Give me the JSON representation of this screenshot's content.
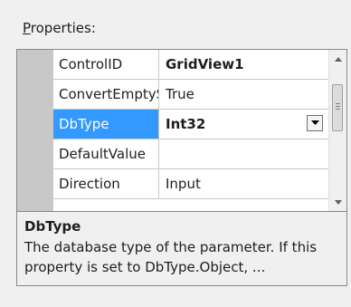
{
  "label": {
    "prefix": "P",
    "rest": "roperties:"
  },
  "grid": {
    "rows": [
      {
        "name": "ControlID",
        "value": "GridView1",
        "value_bold": true,
        "selected": false
      },
      {
        "name": "ConvertEmptyS",
        "value": "True",
        "value_bold": false,
        "selected": false
      },
      {
        "name": "DbType",
        "value": "Int32",
        "value_bold": true,
        "selected": true,
        "has_dropdown": true
      },
      {
        "name": "DefaultValue",
        "value": "",
        "value_bold": false,
        "selected": false
      },
      {
        "name": "Direction",
        "value": "Input",
        "value_bold": false,
        "selected": false
      }
    ]
  },
  "description": {
    "title": "DbType",
    "text": "The database type of the parameter. If this property is set to DbType.Object, ..."
  },
  "colors": {
    "selection": "#3399ff",
    "border": "#828790",
    "background": "#f0f0f0"
  },
  "icons": {
    "dropdown": "chevron-down-icon",
    "scroll_up": "scroll-up-arrow-icon",
    "scroll_down": "scroll-down-arrow-icon"
  }
}
